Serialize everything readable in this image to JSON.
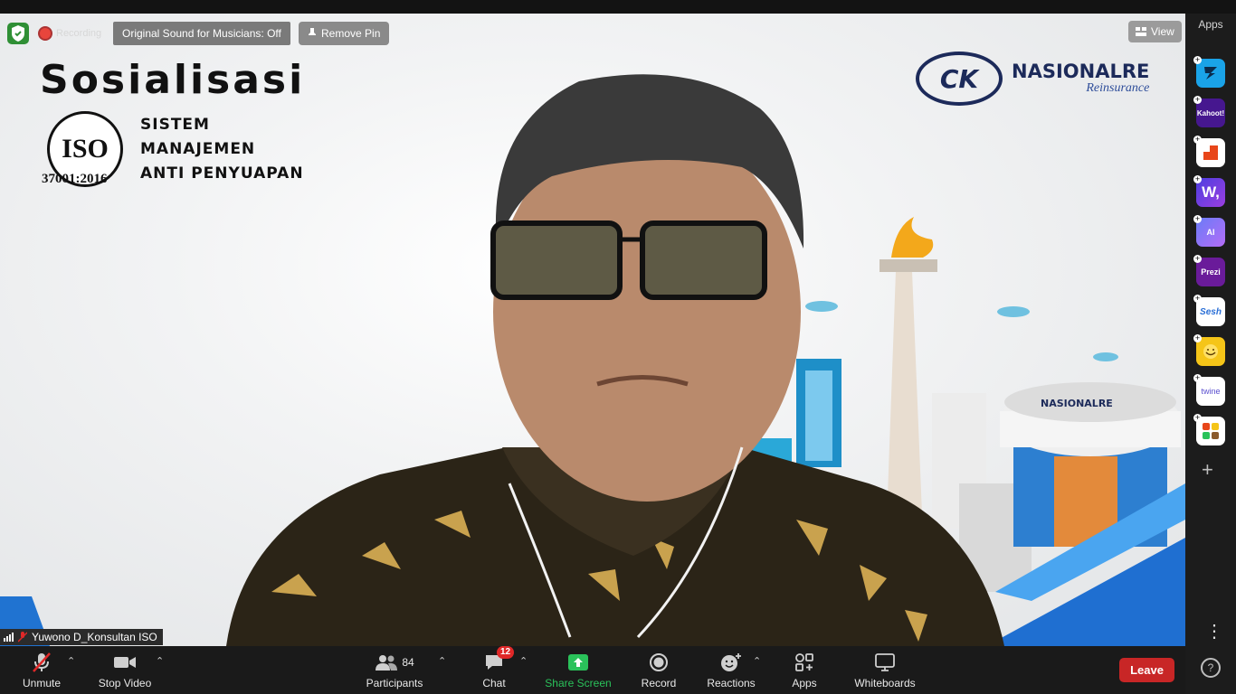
{
  "top_controls": {
    "recording_label": "Recording",
    "original_sound_label": "Original Sound for Musicians: Off",
    "remove_pin_label": "Remove Pin",
    "view_label": "View"
  },
  "video": {
    "banner_title": "Sosialisasi",
    "iso_badge_text": "ISO",
    "iso_number": "37001:2016",
    "system_lines": [
      "SISTEM",
      "MANAJEMEN",
      "ANTI PENYUAPAN"
    ],
    "logo_mark": "CK",
    "logo_name": "NASIONALRE",
    "logo_subtitle": "Reinsurance",
    "participant_name": "Yuwono D_Konsultan ISO"
  },
  "toolbar": {
    "unmute_label": "Unmute",
    "stop_video_label": "Stop Video",
    "participants_label": "Participants",
    "participants_count": "84",
    "chat_label": "Chat",
    "chat_badge": "12",
    "share_screen_label": "Share Screen",
    "record_label": "Record",
    "reactions_label": "Reactions",
    "apps_label": "Apps",
    "whiteboards_label": "Whiteboards",
    "leave_label": "Leave"
  },
  "apps_panel": {
    "title": "Apps",
    "apps": [
      {
        "name": "Flux",
        "label": "",
        "color": "#1aa3e8"
      },
      {
        "name": "Kahoot!",
        "label": "Kahoot!",
        "color": "#46178f"
      },
      {
        "name": "Hypothesis",
        "label": "",
        "color": "#e8461a"
      },
      {
        "name": "Wooclap",
        "label": "W,",
        "color": "#5b3fd6"
      },
      {
        "name": "Slido AI",
        "label": "AI",
        "color": "#4a6cf7"
      },
      {
        "name": "Prezi",
        "label": "Prezi",
        "color": "#6a1b9a"
      },
      {
        "name": "Sesh",
        "label": "Sesh",
        "color": "#ffffff"
      },
      {
        "name": "Emoji app",
        "label": "",
        "color": "#f5c518"
      },
      {
        "name": "Twine",
        "label": "twine",
        "color": "#ffffff"
      },
      {
        "name": "Board app",
        "label": "",
        "color": "#ffffff"
      }
    ]
  },
  "colors": {
    "accent_green": "#2ac25a",
    "leave_red": "#c82626",
    "badge_red": "#e02828"
  }
}
